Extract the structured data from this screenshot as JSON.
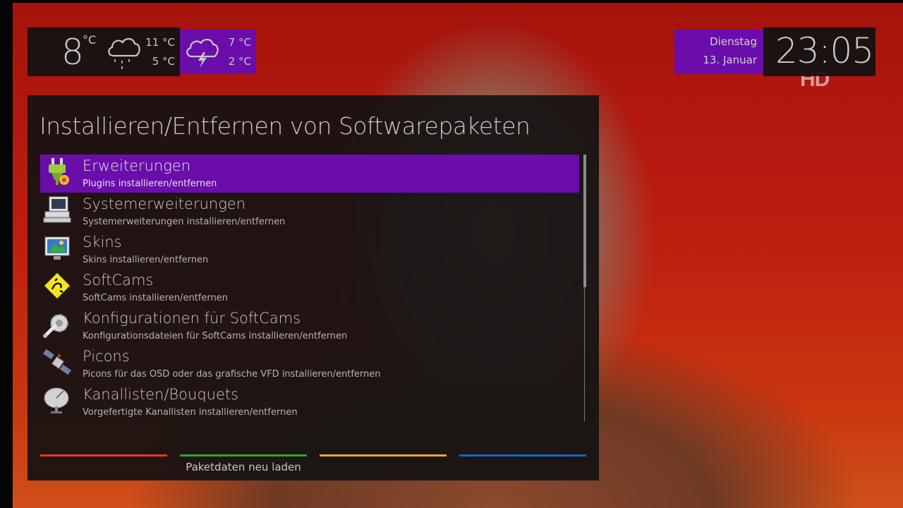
{
  "weather": {
    "current_temp": "8",
    "current_unit": "°C",
    "today_icon": "rain-cloud-icon",
    "today_high": "11 °C",
    "today_low": "5 °C",
    "tomorrow_icon": "thunderstorm-cloud-icon",
    "tomorrow_high": "7 °C",
    "tomorrow_low": "2 °C"
  },
  "clock": {
    "weekday": "Dienstag",
    "date": "13. Januar",
    "time": "23:05"
  },
  "channel_logo": "HD",
  "panel": {
    "title": "Installieren/Entfernen von Softwarepaketen",
    "items": [
      {
        "name": "Erweiterungen",
        "desc": "Plugins installieren/entfernen",
        "icon": "plugin-plug-icon",
        "selected": true
      },
      {
        "name": "Systemerweiterungen",
        "desc": "Systemerweiterungen installieren/entfernen",
        "icon": "computer-icon",
        "selected": false
      },
      {
        "name": "Skins",
        "desc": "Skins installieren/entfernen",
        "icon": "skins-monitor-icon",
        "selected": false
      },
      {
        "name": "SoftCams",
        "desc": "SoftCams installieren/entfernen",
        "icon": "softcam-sign-icon",
        "selected": false
      },
      {
        "name": "Konfigurationen für SoftCams",
        "desc": "Konfigurationsdateien für SoftCams installieren/entfernen",
        "icon": "gear-wrench-icon",
        "selected": false
      },
      {
        "name": "Picons",
        "desc": "Picons für das OSD oder das grafische VFD installieren/entfernen",
        "icon": "satellite-icon",
        "selected": false
      },
      {
        "name": "Kanallisten/Bouquets",
        "desc": "Vorgefertigte Kanallisten installieren/entfernen",
        "icon": "satellite-dish-icon",
        "selected": false
      }
    ]
  },
  "keys": {
    "red": "",
    "green": "Paketdaten neu laden",
    "yellow": "",
    "blue": ""
  },
  "colors": {
    "accent": "#6a0dab",
    "key_red": "#e23a27",
    "key_green": "#2fa232",
    "key_yellow": "#e1a838",
    "key_blue": "#1366c3"
  }
}
